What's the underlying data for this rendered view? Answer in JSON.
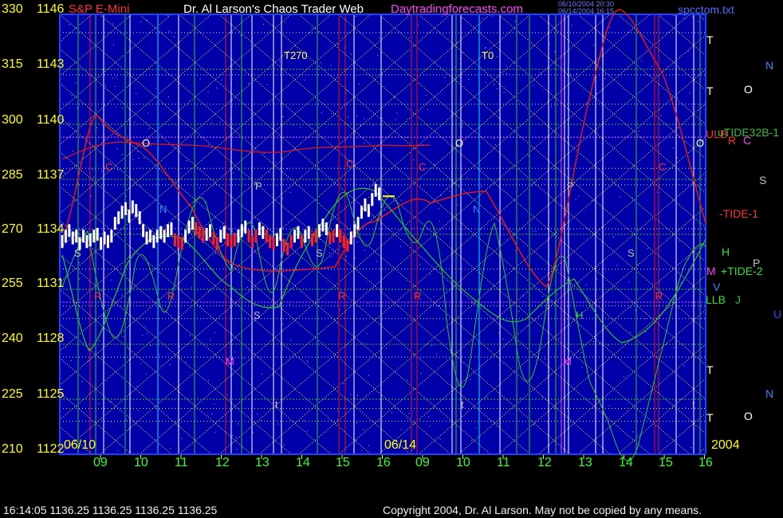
{
  "header": {
    "instrument": "S&P E-Mini",
    "site_title": "Dr. Al Larson's Chaos Trader Web",
    "site_url": "Daytradingforecasts.com",
    "timestamp_line_1": "06/10/2004 20:30",
    "timestamp_line_2": "06/14/2004 16:15",
    "filename": "spcctom.txt"
  },
  "footer": {
    "quote_line": "16:14:05  1136.25 1136.25 1136.25 1136.25",
    "copyright": "Copyright 2004, Dr. Al Larson. May not be copied by any means."
  },
  "colors": {
    "background": "#000000",
    "plot_background": "#0000a8",
    "axis_text": "#ffff00",
    "x_axis_text": "#2eff2e",
    "price_bar": "#ffffff",
    "price_bar_down": "#ff2020",
    "tide_red": "#e01818",
    "tide_green": "#28c428",
    "grid_yellow": "#e8e860",
    "grid_green": "#30c030",
    "title_text": "#ffffff",
    "url_text": "#ff40ff"
  },
  "chart_data": {
    "type": "line",
    "title": "S&P E-Mini",
    "y_axis_left_angles": [
      "330",
      "315",
      "300",
      "285",
      "270",
      "255",
      "240",
      "225",
      "210"
    ],
    "y_axis_prices": [
      "1146",
      "1143",
      "1140",
      "1137",
      "1134",
      "1131",
      "1128",
      "1125",
      "1122"
    ],
    "ylim": [
      1122,
      1146
    ],
    "x_tick_labels": [
      "09",
      "10",
      "11",
      "12",
      "13",
      "14",
      "15",
      "16",
      "09",
      "10",
      "11",
      "12",
      "13",
      "14",
      "15",
      "16"
    ],
    "date_markers": [
      "06/10",
      "06/14",
      "2004"
    ],
    "last_price": 1136.25,
    "price_series_06_10": [
      1133.6,
      1133.9,
      1134.2,
      1133.8,
      1133.9,
      1133.5,
      1133.9,
      1133.6,
      1133.7,
      1133.9,
      1134.0,
      1133.5,
      1133.8,
      1133.6,
      1133.9,
      1134.6,
      1134.9,
      1135.2,
      1135.4,
      1135.0,
      1135.5,
      1135.3,
      1134.9,
      1134.2,
      1133.8,
      1133.9,
      1133.6,
      1133.9,
      1134.1,
      1133.9,
      1134.2,
      1134.3,
      1133.7,
      1133.6,
      1133.5,
      1133.9,
      1134.4,
      1134.6,
      1134.3,
      1134.1,
      1133.9,
      1134.0,
      1134.2,
      1133.8,
      1133.5,
      1133.9,
      1134.1,
      1133.7,
      1133.6,
      1133.7,
      1133.9,
      1134.2,
      1134.4,
      1133.9,
      1133.6,
      1133.9,
      1134.3,
      1134.1,
      1133.9,
      1133.6,
      1133.5,
      1133.7,
      1134.0,
      1133.4,
      1133.2,
      1133.6,
      1133.9,
      1134.1,
      1133.6,
      1133.9,
      1134.1,
      1133.7,
      1133.9,
      1134.2,
      1134.5,
      1134.3,
      1133.8,
      1133.9,
      1134.2,
      1133.9,
      1133.6,
      1133.4,
      1133.8,
      1134.2,
      1134.6,
      1135.2,
      1135.6,
      1135.3,
      1135.9,
      1136.4,
      1136.2
    ],
    "down_bar_flags": [
      0,
      0,
      0,
      0,
      0,
      0,
      0,
      0,
      0,
      0,
      0,
      0,
      0,
      0,
      0,
      0,
      0,
      0,
      0,
      0,
      0,
      0,
      0,
      0,
      0,
      0,
      0,
      0,
      0,
      0,
      0,
      0,
      1,
      1,
      1,
      0,
      0,
      0,
      1,
      1,
      1,
      0,
      0,
      1,
      1,
      0,
      0,
      1,
      1,
      1,
      0,
      0,
      0,
      1,
      1,
      1,
      0,
      0,
      1,
      1,
      1,
      0,
      0,
      1,
      1,
      1,
      0,
      0,
      1,
      0,
      0,
      1,
      1,
      0,
      0,
      0,
      1,
      1,
      0,
      1,
      1,
      1,
      0,
      0,
      0,
      0,
      0,
      0,
      0,
      0,
      0
    ],
    "series": [
      {
        "name": "-TIDE-1"
      },
      {
        "name": "+TIDE-2"
      },
      {
        "name": "uTIDE32B-1"
      }
    ],
    "chart_annotations": {
      "top_labels": [
        "T270",
        "T0"
      ],
      "right_labels": [
        "T",
        "T",
        "T",
        "T",
        "N",
        "O",
        "S",
        "H",
        "P",
        "M",
        "V",
        "J",
        "N",
        "O",
        "U",
        "C",
        "R",
        "LLB",
        "ULB",
        "-TIDE-1",
        "+TIDE-2",
        "uTIDE32B-1"
      ],
      "in_plot_glyphs": [
        "C",
        "C",
        "C",
        "C",
        "O",
        "O",
        "O",
        "N",
        "N",
        "P",
        "P",
        "S",
        "S",
        "S",
        "S",
        "R",
        "R",
        "R",
        "R",
        "R",
        "M",
        "M",
        "H",
        "t",
        "t",
        "t"
      ]
    }
  }
}
